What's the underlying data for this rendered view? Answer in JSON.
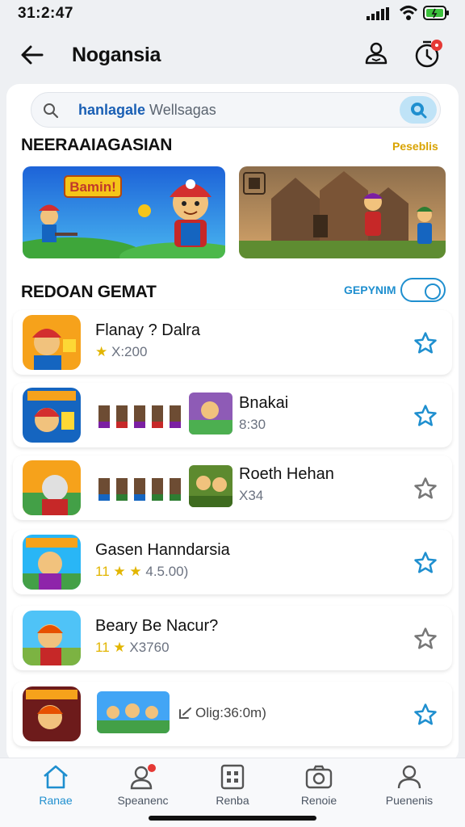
{
  "status": {
    "time": "31:2:47"
  },
  "header": {
    "title": "Nogansia"
  },
  "search": {
    "query_bold": "hanlagale",
    "query_rest": "Wellsagas"
  },
  "featured": {
    "title": "NEERAAIAGASIAN",
    "link": "Peseblis"
  },
  "list": {
    "title": "REDOAN GEMAT",
    "toggle_label": "GEPYNIM",
    "games": [
      {
        "name": "Flanay ? Dalra",
        "star": "★",
        "prefix": "",
        "meta": "X:200",
        "favorited": true
      },
      {
        "name": "Bnakai",
        "star": "",
        "prefix": "",
        "meta": "8:30",
        "favorited": true
      },
      {
        "name": "Roeth Hehan",
        "star": "",
        "prefix": "",
        "meta": "X34",
        "favorited": false
      },
      {
        "name": "Gasen Hanndarsia",
        "star": "★",
        "prefix": "11",
        "meta": "4.5.00)",
        "favorited": true
      },
      {
        "name": "Beary Be Nacur?",
        "star": "★",
        "prefix": "11",
        "meta": "X3760",
        "favorited": false
      },
      {
        "name": "",
        "star": "",
        "prefix": "",
        "meta": "Olig:36:0m)",
        "favorited": true
      }
    ]
  },
  "nav": [
    {
      "label": "Ranae",
      "icon": "home-icon",
      "active": true
    },
    {
      "label": "Speanenc",
      "icon": "profile-notification-icon",
      "active": false
    },
    {
      "label": "Renba",
      "icon": "grid-icon",
      "active": false
    },
    {
      "label": "Renoie",
      "icon": "camera-icon",
      "active": false
    },
    {
      "label": "Puenenis",
      "icon": "person-icon",
      "active": false
    }
  ],
  "colors": {
    "accent": "#1f8fcf",
    "gold": "#e2b500",
    "link_gold": "#d9a300"
  }
}
